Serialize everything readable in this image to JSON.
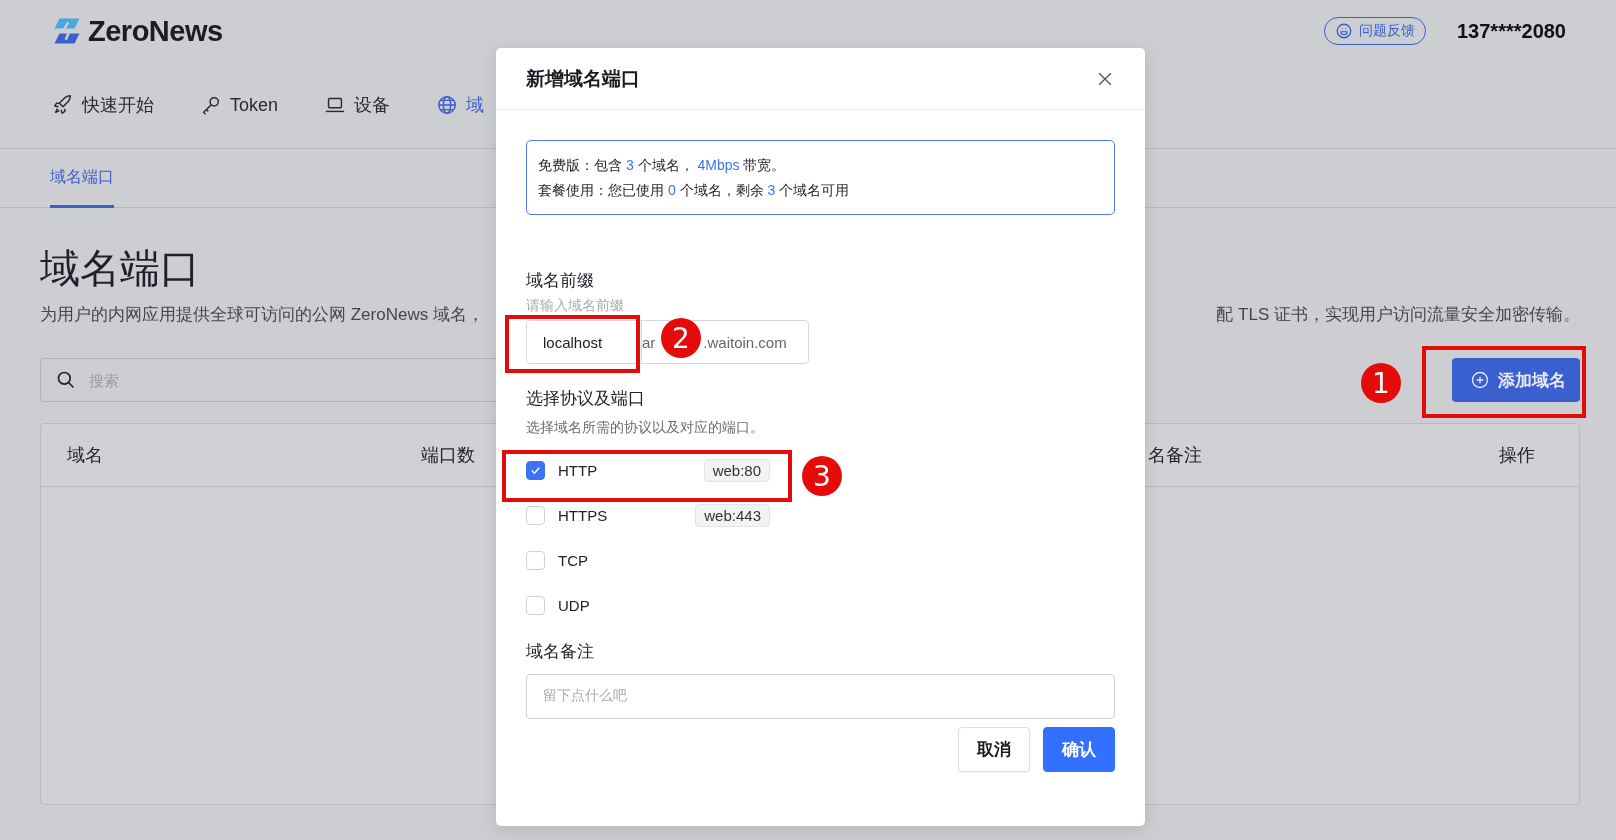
{
  "brand": {
    "name": "ZeroNews"
  },
  "feedback_button": {
    "label": "问题反馈"
  },
  "user": {
    "phone": "137****2080"
  },
  "nav": [
    {
      "label": "快速开始",
      "selected": false
    },
    {
      "label": "Token",
      "selected": false
    },
    {
      "label": "设备",
      "selected": false
    },
    {
      "label": "域",
      "selected": true
    }
  ],
  "subtabs": [
    {
      "label": "域名端口",
      "selected": true
    }
  ],
  "page": {
    "title": "域名端口",
    "description_left": "为用户的内网应用提供全球可访问的公网 ZeroNews 域名，",
    "description_right": "配 TLS 证书，实现用户访问流量安全加密传输。",
    "search": {
      "placeholder": "搜索"
    },
    "add_button": {
      "label": "添加域名"
    },
    "table": {
      "columns": [
        "域名",
        "端口数",
        "名备注",
        "操作"
      ]
    }
  },
  "dialog": {
    "title": "新增域名端口",
    "info": [
      [
        {
          "text": "免费版：包含 ",
          "highlight": false
        },
        {
          "text": "3",
          "highlight": true
        },
        {
          "text": " 个域名， ",
          "highlight": false
        },
        {
          "text": "4Mbps",
          "highlight": true
        },
        {
          "text": " 带宽。",
          "highlight": false
        }
      ],
      [
        {
          "text": "套餐使用：您已使用 ",
          "highlight": false
        },
        {
          "text": "0",
          "highlight": true
        },
        {
          "text": " 个域名，剩余 ",
          "highlight": false
        },
        {
          "text": "3",
          "highlight": true
        },
        {
          "text": " 个域名可用",
          "highlight": false
        }
      ]
    ],
    "prefix": {
      "label": "域名前缀",
      "hint": "请输入域名前缀",
      "value": "localhost",
      "suffix_partial": "ar",
      "suffix": ".waitoin.com"
    },
    "protocol": {
      "label": "选择协议及端口",
      "description": "选择域名所需的协议以及对应的端口。",
      "options": [
        {
          "label": "HTTP",
          "checked": true,
          "port": "web:80"
        },
        {
          "label": "HTTPS",
          "checked": false,
          "port": "web:443"
        },
        {
          "label": "TCP",
          "checked": false
        },
        {
          "label": "UDP",
          "checked": false
        }
      ]
    },
    "remark": {
      "label": "域名备注",
      "placeholder": "留下点什么吧"
    },
    "buttons": [
      {
        "label": "取消",
        "kind": "secondary"
      },
      {
        "label": "确认",
        "kind": "primary"
      }
    ]
  },
  "annotations": [
    {
      "number": "1"
    },
    {
      "number": "2"
    },
    {
      "number": "3"
    }
  ]
}
